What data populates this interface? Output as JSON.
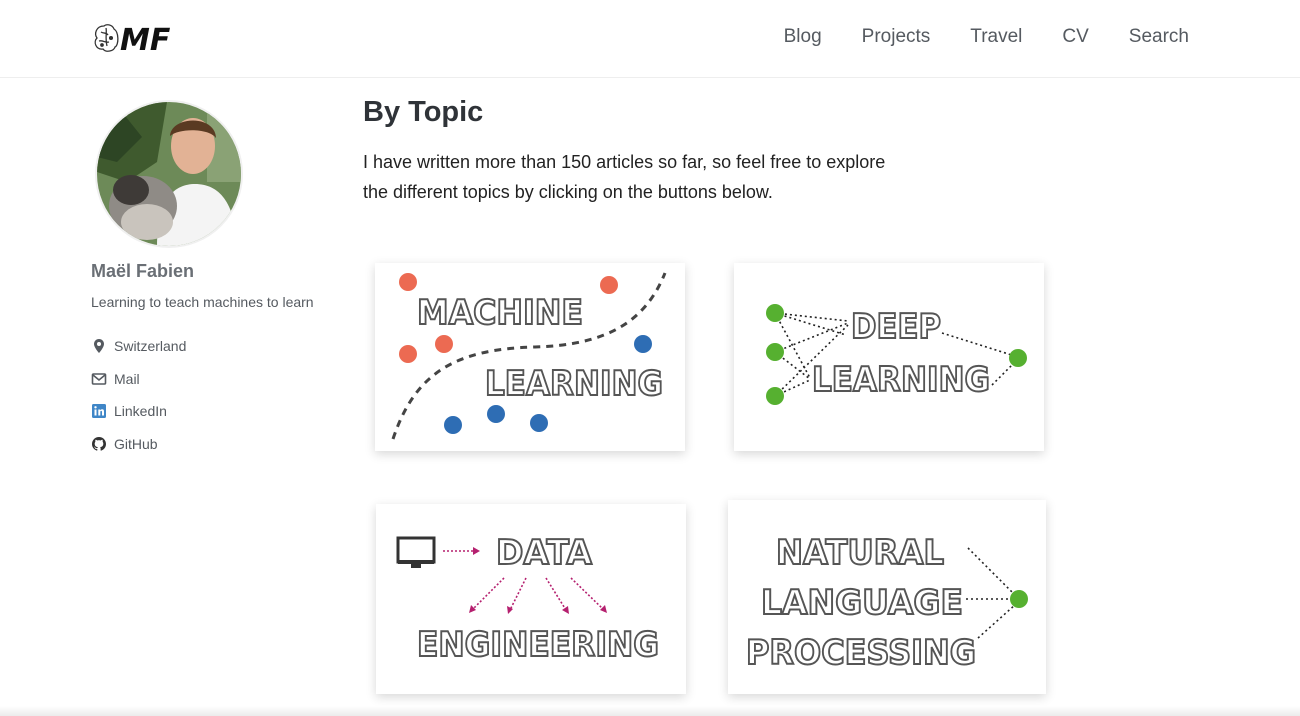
{
  "header": {
    "logo_text": "MF",
    "nav": [
      "Blog",
      "Projects",
      "Travel",
      "CV",
      "Search"
    ]
  },
  "author": {
    "name": "Maël Fabien",
    "bio": "Learning to teach machines to learn",
    "links": [
      {
        "icon": "map-marker-icon",
        "label": "Switzerland"
      },
      {
        "icon": "envelope-icon",
        "label": "Mail"
      },
      {
        "icon": "linkedin-icon",
        "label": "LinkedIn"
      },
      {
        "icon": "github-icon",
        "label": "GitHub"
      }
    ]
  },
  "main": {
    "title": "By Topic",
    "intro_line1": "I have written more than 150 articles so far, so feel free to explore",
    "intro_line2": "the different topics by clicking on the buttons below.",
    "topics": [
      {
        "line1": "MACHINE",
        "line2": "LEARNING"
      },
      {
        "line1": "DEEP",
        "line2": "LEARNING"
      },
      {
        "line1": "DATA",
        "line2": "ENGINEERING"
      },
      {
        "line1": "NATURAL",
        "line2": "LANGUAGE",
        "line3": "PROCESSING"
      }
    ]
  },
  "colors": {
    "red_dot": "#ec6a52",
    "blue_dot": "#2e6db4",
    "green_node": "#56b030",
    "arrow_magenta": "#b5206f",
    "outline_text": "#555555"
  }
}
